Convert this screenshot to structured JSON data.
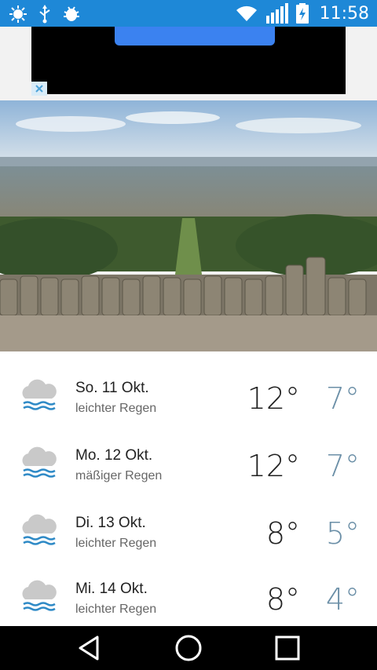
{
  "status_bar": {
    "time": "11:58",
    "icons": [
      "brightness-icon",
      "usb-icon",
      "android-debug-icon",
      "wifi-icon",
      "signal-icon",
      "battery-charging-icon"
    ]
  },
  "ad": {
    "close_icon": "close-icon"
  },
  "forecast": [
    {
      "date": "So. 11 Okt.",
      "condition": "leichter Regen",
      "high": "12°",
      "low": "7°",
      "icon": "rain-cloud-icon"
    },
    {
      "date": "Mo. 12 Okt.",
      "condition": "mäßiger Regen",
      "high": "12°",
      "low": "7°",
      "icon": "rain-cloud-icon"
    },
    {
      "date": "Di. 13 Okt.",
      "condition": "leichter Regen",
      "high": "8°",
      "low": "5°",
      "icon": "rain-cloud-icon"
    },
    {
      "date": "Mi. 14 Okt.",
      "condition": "leichter Regen",
      "high": "8°",
      "low": "4°",
      "icon": "rain-cloud-icon"
    }
  ],
  "colors": {
    "status_bar": "#1e88d7",
    "low_temp": "#6b8fa7",
    "rain": "#2f8ac6"
  },
  "nav": {
    "back_icon": "back-triangle-icon",
    "home_icon": "home-circle-icon",
    "recents_icon": "recents-square-icon"
  }
}
